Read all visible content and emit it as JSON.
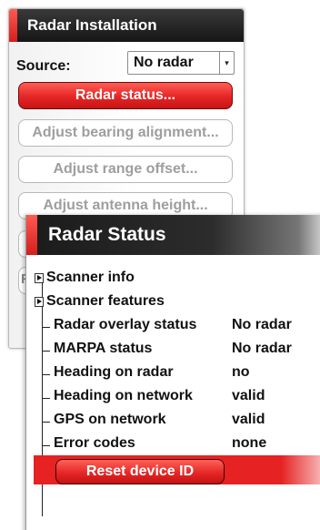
{
  "installation": {
    "title": "Radar Installation",
    "source_label": "Source:",
    "source_value": "No radar",
    "buttons": {
      "radar_status": "Radar status...",
      "bearing": "Adjust bearing alignment...",
      "range": "Adjust range offset...",
      "antenna": "Adjust antenna height..."
    },
    "partial_label": "F"
  },
  "status_dialog": {
    "title": "Radar Status",
    "expanders": [
      {
        "label": "Scanner info"
      },
      {
        "label": "Scanner features"
      }
    ],
    "rows": [
      {
        "label": "Radar overlay status",
        "value": "No radar"
      },
      {
        "label": "MARPA status",
        "value": "No radar"
      },
      {
        "label": "Heading on radar",
        "value": "no"
      },
      {
        "label": "Heading on network",
        "value": "valid"
      },
      {
        "label": "GPS on network",
        "value": "valid"
      },
      {
        "label": "Error codes",
        "value": "none"
      }
    ],
    "reset_button": "Reset device ID"
  },
  "colors": {
    "accent_red": "#e52525",
    "title_bar": "#1f1f1f"
  }
}
